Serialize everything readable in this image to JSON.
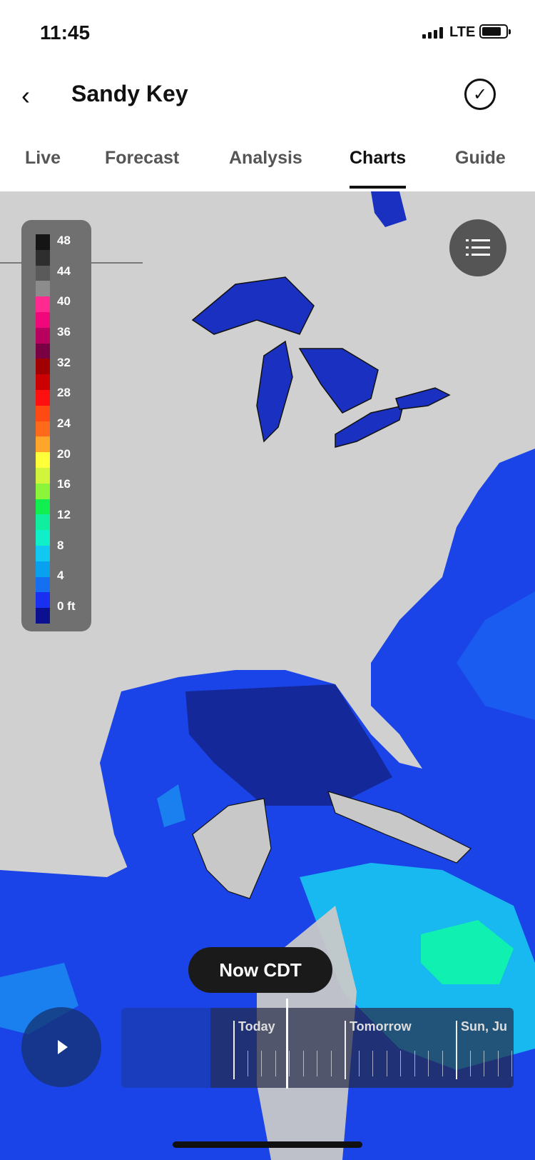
{
  "status_bar": {
    "time": "11:45",
    "network": "LTE",
    "icons": [
      "signal-icon",
      "battery-icon"
    ]
  },
  "header": {
    "title": "Sandy Key",
    "back_icon": "chevron-left-icon",
    "done_icon": "checkmark-circle-icon"
  },
  "tabs": [
    {
      "label": "Live"
    },
    {
      "label": "Forecast"
    },
    {
      "label": "Analysis"
    },
    {
      "label": "Charts",
      "active": true
    },
    {
      "label": "Guide"
    }
  ],
  "legend": {
    "labels": [
      "48",
      "44",
      "40",
      "36",
      "32",
      "28",
      "24",
      "20",
      "16",
      "12",
      "8",
      "4",
      "0 ft"
    ],
    "colors": [
      "#151515",
      "#2e2e2e",
      "#5a5a5a",
      "#8c8c8c",
      "#ff2a90",
      "#f0077a",
      "#b8005e",
      "#7a0044",
      "#a00000",
      "#cc0000",
      "#ff1010",
      "#ff4a14",
      "#ff6a1a",
      "#ffa52a",
      "#ffff3a",
      "#d0f53a",
      "#8af53a",
      "#10ee50",
      "#10eea0",
      "#10f0c8",
      "#10c8f0",
      "#0aa0f0",
      "#1470f0",
      "#1a30f0",
      "#0a1090"
    ]
  },
  "map": {
    "menu_icon": "list-icon",
    "land_color": "#d0d0d0",
    "ocean_color": "#1a44e8"
  },
  "timeline": {
    "now_label": "Now CDT",
    "days": [
      "Today",
      "Tomorrow",
      "Sun, Ju"
    ],
    "play_icon": "play-icon"
  }
}
